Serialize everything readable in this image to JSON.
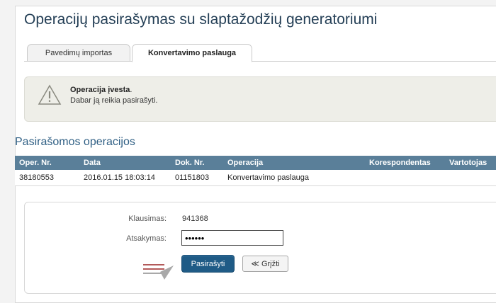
{
  "page": {
    "title": "Operacijų pasirašymas su slaptažodžių generatoriumi"
  },
  "tabs": [
    {
      "label": "Pavedimų importas",
      "active": false
    },
    {
      "label": "Konvertavimo paslauga",
      "active": true
    }
  ],
  "alert": {
    "icon": "warning-icon",
    "title": "Operacija įvesta",
    "title_suffix": ".",
    "message": "Dabar ją reikia pasirašyti."
  },
  "operations": {
    "section_title": "Pasirašomos operacijos",
    "columns": [
      "Oper. Nr.",
      "Data",
      "Dok. Nr.",
      "Operacija",
      "Korespondentas",
      "Vartotojas"
    ],
    "rows": [
      [
        "38180553",
        "2016.01.15 18:03:14",
        "01151803",
        "Konvertavimo paslauga",
        "",
        ""
      ]
    ],
    "header_color": "#5a7f99"
  },
  "form": {
    "question_label": "Klausimas:",
    "question_value": "941368",
    "answer_label": "Atsakymas:",
    "answer_value": "••••••",
    "sign_label": "Pasirašyti",
    "back_label": "≪ Grįžti",
    "sign_color": "#1f5b86",
    "hint_arrow": "arrow-right-icon"
  }
}
